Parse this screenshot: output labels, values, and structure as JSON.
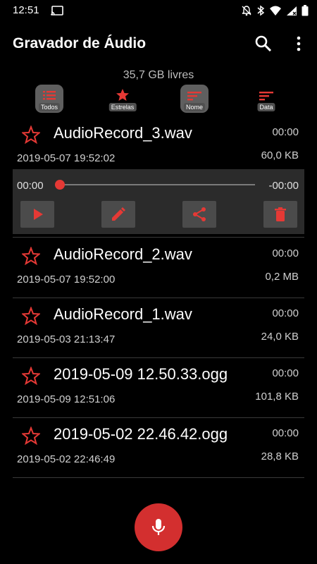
{
  "status_bar": {
    "time": "12:51",
    "icons": [
      "cast-icon",
      "notifications-off-icon",
      "bluetooth-icon",
      "wifi-icon",
      "signal-icon",
      "battery-icon"
    ]
  },
  "app_bar": {
    "title": "Gravador de Áudio",
    "icons": [
      "search-icon",
      "more-vert-icon"
    ]
  },
  "storage_text": "35,7 GB livres",
  "sort_buttons": [
    {
      "label": "Todos",
      "icon": "list-icon"
    },
    {
      "label": "Estrelas",
      "icon": "star-icon"
    },
    {
      "label": "Nome",
      "icon": "sort-icon"
    },
    {
      "label": "Data",
      "icon": "sort-icon"
    }
  ],
  "records": [
    {
      "name": "AudioRecord_3.wav",
      "duration": "00:00",
      "date": "2019-05-07 19:52:02",
      "size": "60,0 KB"
    },
    {
      "name": "AudioRecord_2.wav",
      "duration": "00:00",
      "date": "2019-05-07 19:52:00",
      "size": "0,2 MB"
    },
    {
      "name": "AudioRecord_1.wav",
      "duration": "00:00",
      "date": "2019-05-03 21:13:47",
      "size": "24,0 KB"
    },
    {
      "name": "2019-05-09 12.50.33.ogg",
      "duration": "00:00",
      "date": "2019-05-09 12:51:06",
      "size": "101,8 KB"
    },
    {
      "name": "2019-05-02 22.46.42.ogg",
      "duration": "00:00",
      "date": "2019-05-02 22:46:49",
      "size": "28,8 KB"
    }
  ],
  "player": {
    "current_time": "00:00",
    "remaining_time": "-00:00",
    "progress": 0,
    "buttons": [
      "play-icon",
      "edit-icon",
      "share-icon",
      "delete-icon"
    ]
  },
  "fab": {
    "icon": "mic-icon"
  },
  "colors": {
    "accent": "#e53935",
    "background": "#000000",
    "player_background": "#2b2b2b"
  }
}
